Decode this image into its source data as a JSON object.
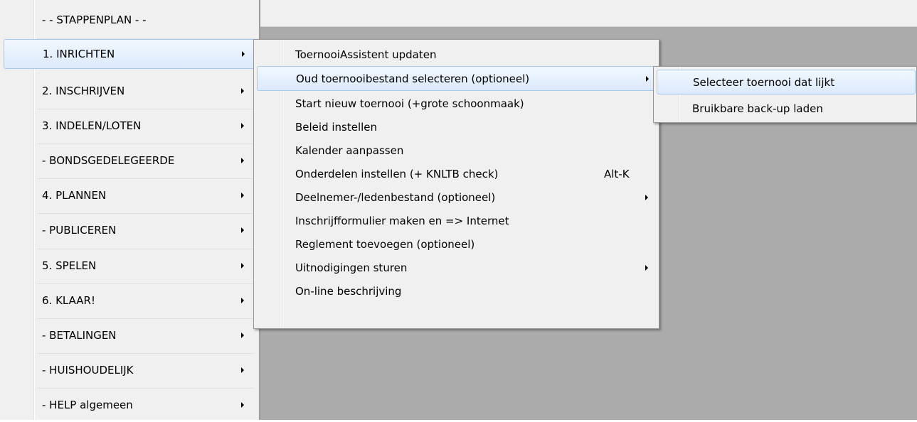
{
  "main_menu": {
    "items": [
      {
        "label": "- -  STAPPENPLAN  - -",
        "has_submenu": false
      },
      {
        "label": "1. INRICHTEN",
        "has_submenu": true,
        "highlighted": true
      },
      {
        "label": "2. INSCHRIJVEN",
        "has_submenu": true
      },
      {
        "label": "3. INDELEN/LOTEN",
        "has_submenu": true
      },
      {
        "label": "-  BONDSGEDELEGEERDE",
        "has_submenu": true
      },
      {
        "label": "4. PLANNEN",
        "has_submenu": true
      },
      {
        "label": "-  PUBLICEREN",
        "has_submenu": true
      },
      {
        "label": "5. SPELEN",
        "has_submenu": true
      },
      {
        "label": "6. KLAAR!",
        "has_submenu": true
      },
      {
        "label": "-  BETALINGEN",
        "has_submenu": true
      },
      {
        "label": "-  HUISHOUDELIJK",
        "has_submenu": true
      },
      {
        "label": "-  HELP algemeen",
        "has_submenu": true
      }
    ]
  },
  "sub_menu": {
    "items": [
      {
        "label": "ToernooiAssistent updaten"
      },
      {
        "label": "Oud toernooibestand selecteren (optioneel)",
        "has_submenu": true,
        "highlighted": true
      },
      {
        "label": "Start nieuw toernooi (+grote schoonmaak)"
      },
      {
        "label": "Beleid instellen"
      },
      {
        "label": "Kalender aanpassen"
      },
      {
        "label": "Onderdelen instellen (+ KNLTB check)",
        "shortcut": "Alt-K"
      },
      {
        "label": "Deelnemer-/ledenbestand (optioneel)",
        "has_submenu": true
      },
      {
        "label": "Inschrijfformulier maken en => Internet"
      },
      {
        "label": "Reglement toevoegen (optioneel)"
      },
      {
        "label": "Uitnodigingen sturen",
        "has_submenu": true
      },
      {
        "label": "On-line beschrijving"
      }
    ]
  },
  "subsub_menu": {
    "items": [
      {
        "label": "Selecteer toernooi dat lijkt",
        "highlighted": true
      },
      {
        "label": "Bruikbare back-up laden"
      }
    ]
  },
  "colors": {
    "menu_bg": "#f0f0f0",
    "highlight_border": "#a8c8ee",
    "app_background": "#ababab"
  }
}
